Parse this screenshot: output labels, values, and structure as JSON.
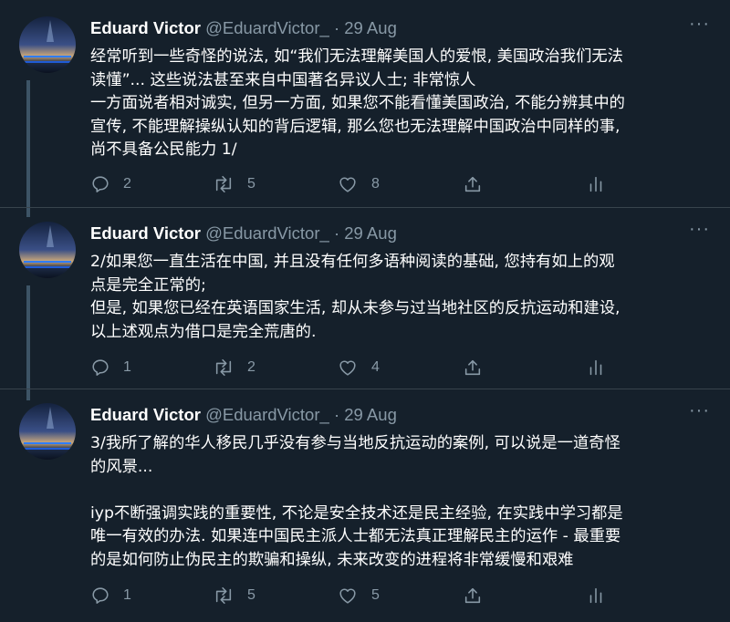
{
  "tweets": [
    {
      "name": "Eduard Victor",
      "handle": "@EduardVictor_",
      "date": "· 29 Aug",
      "more": "···",
      "lines": [
        "经常听到一些奇怪的说法, 如“我们无法理解美国人的爱恨, 美国政治我们无法",
        "读懂”... 这些说法甚至来自中国著名异议人士; 非常惊人",
        "一方面说者相对诚实, 但另一方面, 如果您不能看懂美国政治, 不能分辨其中的",
        "宣传, 不能理解操纵认知的背后逻辑, 那么您也无法理解中国政治中同样的事,",
        "尚不具备公民能力 1/"
      ],
      "replies": "2",
      "retweets": "5",
      "likes": "8"
    },
    {
      "name": "Eduard Victor",
      "handle": "@EduardVictor_",
      "date": "· 29 Aug",
      "more": "···",
      "lines": [
        "2/如果您一直生活在中国, 并且没有任何多语种阅读的基础, 您持有如上的观",
        "点是完全正常的;",
        "但是, 如果您已经在英语国家生活, 却从未参与过当地社区的反抗运动和建设,",
        "以上述观点为借口是完全荒唐的."
      ],
      "replies": "1",
      "retweets": "2",
      "likes": "4"
    },
    {
      "name": "Eduard Victor",
      "handle": "@EduardVictor_",
      "date": "· 29 Aug",
      "more": "···",
      "lines": [
        "3/我所了解的华人移民几乎没有参与当地反抗运动的案例, 可以说是一道奇怪",
        "的风景...",
        "",
        "iyp不断强调实践的重要性, 不论是安全技术还是民主经验, 在实践中学习都是",
        "唯一有效的办法. 如果连中国民主派人士都无法真正理解民主的运作 - 最重要",
        "的是如何防止伪民主的欺骗和操纵, 未来改变的进程将非常缓慢和艰难"
      ],
      "replies": "1",
      "retweets": "5",
      "likes": "5"
    }
  ],
  "icons": {
    "reply": "reply-icon",
    "retweet": "retweet-icon",
    "like": "heart-icon",
    "share": "share-icon",
    "analytics": "analytics-icon"
  },
  "colors": {
    "background": "#15202b",
    "text": "#ffffff",
    "secondary": "#8899a6",
    "divider": "#38444d",
    "thread": "#3d5466"
  }
}
